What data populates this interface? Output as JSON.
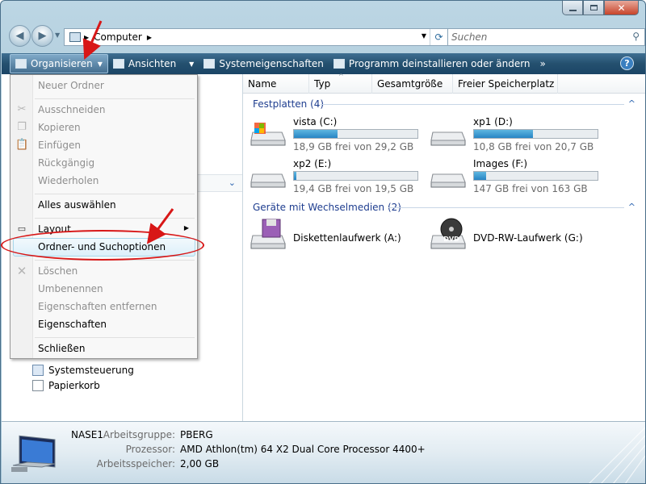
{
  "window": {
    "caption_buttons": [
      "minimize",
      "maximize",
      "close"
    ]
  },
  "address": {
    "breadcrumb": "Computer",
    "search_placeholder": "Suchen"
  },
  "toolbar": {
    "organize": "Organisieren",
    "views": "Ansichten",
    "system_properties": "Systemeigenschaften",
    "uninstall": "Programm deinstallieren oder ändern",
    "more": "»",
    "help": "?"
  },
  "columns": [
    "Name",
    "Typ",
    "Gesamtgröße",
    "Freier Speicherplatz"
  ],
  "groups": {
    "harddisks": "Festplatten (4)",
    "removable": "Geräte mit Wechselmedien (2)"
  },
  "drives": [
    {
      "name": "vista (C:)",
      "free": "18,9 GB frei von 29,2 GB",
      "used_fraction": 0.35
    },
    {
      "name": "xp1 (D:)",
      "free": "10,8 GB frei von 20,7 GB",
      "used_fraction": 0.48
    },
    {
      "name": "xp2 (E:)",
      "free": "19,4 GB frei von 19,5 GB",
      "used_fraction": 0.01
    },
    {
      "name": "Images (F:)",
      "free": "147 GB frei von 163 GB",
      "used_fraction": 0.1
    }
  ],
  "removable": [
    {
      "name": "Diskettenlaufwerk (A:)"
    },
    {
      "name": "DVD-RW-Laufwerk (G:)",
      "label": "DVD"
    }
  ],
  "menu": {
    "new_folder": "Neuer Ordner",
    "cut": "Ausschneiden",
    "copy": "Kopieren",
    "paste": "Einfügen",
    "undo": "Rückgängig",
    "redo": "Wiederholen",
    "select_all": "Alles auswählen",
    "layout": "Layout",
    "folder_options": "Ordner- und Suchoptionen",
    "delete": "Löschen",
    "rename": "Umbenennen",
    "remove_properties": "Eigenschaften entfernen",
    "properties": "Eigenschaften",
    "close": "Schließen"
  },
  "nav": {
    "control_panel": "Systemsteuerung",
    "recycle_bin": "Papierkorb"
  },
  "details": {
    "computer_name": "NASE1",
    "workgroup_label": "Arbeitsgruppe:",
    "workgroup": "PBERG",
    "processor_label": "Prozessor:",
    "processor": "AMD Athlon(tm) 64 X2 Dual Core Processor 4400+",
    "memory_label": "Arbeitsspeicher:",
    "memory": "2,00 GB"
  },
  "colors": {
    "toolbar": "#24506f",
    "annotation": "#d81717",
    "group_text": "#1e3d8f",
    "bar_fill": "#2785c4"
  }
}
